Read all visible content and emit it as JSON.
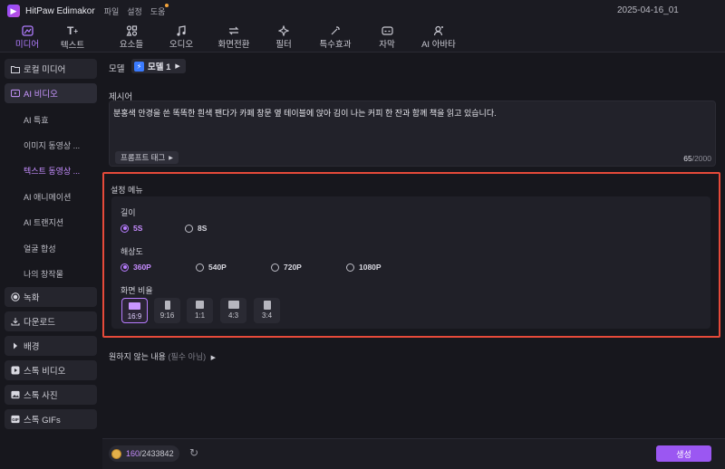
{
  "titlebar": {
    "app_title": "HitPaw Edimakor",
    "menus": [
      "파일",
      "설정",
      "도움"
    ],
    "project_name": "2025-04-16_01"
  },
  "tabs": [
    {
      "label": "미디어",
      "icon": "media-icon",
      "active": true
    },
    {
      "label": "텍스트",
      "icon": "text-icon",
      "active": false
    },
    {
      "label": "요소들",
      "icon": "elements-icon",
      "active": false
    },
    {
      "label": "오디오",
      "icon": "audio-icon",
      "active": false
    },
    {
      "label": "화면전환",
      "icon": "transition-icon",
      "active": false
    },
    {
      "label": "필터",
      "icon": "filter-icon",
      "active": false
    },
    {
      "label": "특수효과",
      "icon": "effects-icon",
      "active": false
    },
    {
      "label": "자막",
      "icon": "subtitle-icon",
      "active": false
    },
    {
      "label": "AI 아바타",
      "icon": "avatar-icon",
      "active": false
    }
  ],
  "sidebar": {
    "local_media": "로컬 미디어",
    "ai_video": "AI 비디오",
    "subitems": [
      "AI 특효",
      "이미지 동영상 ...",
      "텍스트 동영상 ...",
      "AI 애니메이션",
      "AI 트랜지션",
      "얼굴 합성",
      "나의 창작물"
    ],
    "active_subitem": 2,
    "record": "녹화",
    "download": "다운로드",
    "background": "배경",
    "stock_video": "스톡 비디오",
    "stock_photo": "스톡 사진",
    "stock_gifs": "스톡 GIFs"
  },
  "model": {
    "label": "모델",
    "value": "모델 1"
  },
  "prompt": {
    "label": "제시어",
    "text": "분홍색 안경을 쓴 똑똑한 흰색 팬다가 카페 창문 옆 테이블에 앉아 김이 나는 커피 한 잔과 함께 책을 읽고 있습니다.",
    "tag_button": "프롬프트 태그",
    "count": "65",
    "max": "/2000"
  },
  "settings": {
    "title": "설정 메뉴",
    "length": {
      "label": "길이",
      "options": [
        "5S",
        "8S"
      ],
      "selected": "5S"
    },
    "resolution": {
      "label": "해상도",
      "options": [
        "360P",
        "540P",
        "720P",
        "1080P"
      ],
      "selected": "360P"
    },
    "aspect": {
      "label": "화면 비율",
      "options": [
        "16:9",
        "9:16",
        "1:1",
        "4:3",
        "3:4"
      ],
      "selected": "16:9"
    }
  },
  "negative": {
    "label": "원하지 않는 내용",
    "optional": "(필수 아님)"
  },
  "bottom": {
    "credits_current": "160",
    "credits_total": "/2433842",
    "generate": "생성"
  },
  "colors": {
    "accent": "#b77cff",
    "highlight_border": "#e64a3a",
    "generate_button": "#9b57f2"
  }
}
